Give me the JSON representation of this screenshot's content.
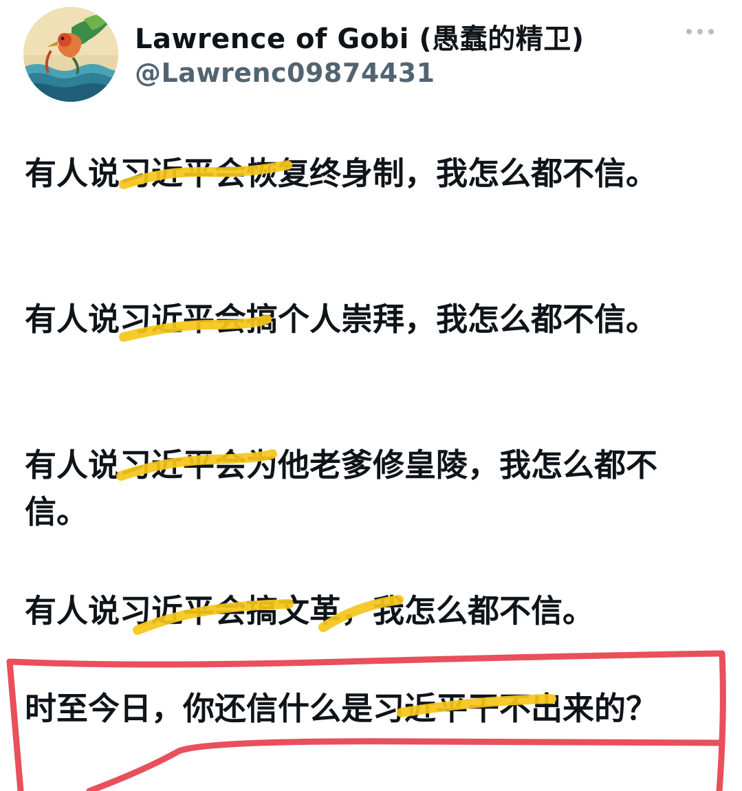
{
  "author": {
    "display_name": "Lawrence of Gobi (愚蠢的精卫)",
    "handle": "@Lawrenc09874431",
    "avatar_icon": "bird-avatar-icon"
  },
  "menu": {
    "more_icon": "more-horizontal-icon"
  },
  "tweet": {
    "paragraphs": [
      "有人说习近平会恢复终身制，我怎么都不信。",
      "有人说习近平会搞个人崇拜，我怎么都不信。",
      "有人说习近平会为他老爹修皇陵，我怎么都不信。",
      "有人说习近平会搞文革，我怎么都不信。",
      "时至今日，你还信什么是习近平干不出来的？"
    ]
  },
  "annotations": {
    "highlight_color": "#f5c518",
    "box_color": "#e8505b"
  }
}
